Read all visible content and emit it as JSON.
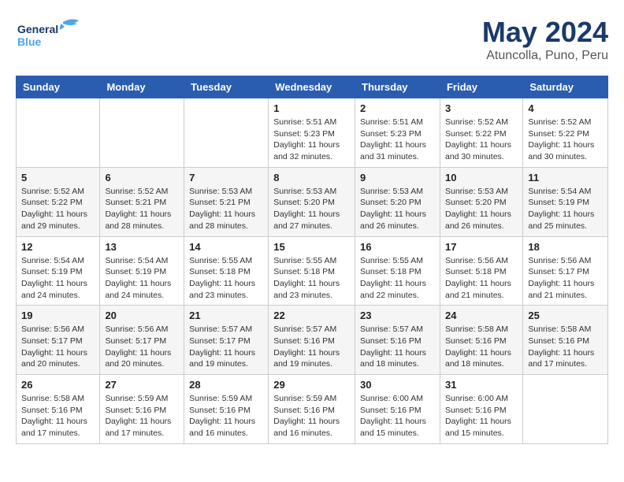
{
  "header": {
    "logo_general": "General",
    "logo_blue": "Blue",
    "main_title": "May 2024",
    "subtitle": "Atuncolla, Puno, Peru"
  },
  "weekdays": [
    "Sunday",
    "Monday",
    "Tuesday",
    "Wednesday",
    "Thursday",
    "Friday",
    "Saturday"
  ],
  "weeks": [
    [
      {
        "day": "",
        "sunrise": "",
        "sunset": "",
        "daylight": ""
      },
      {
        "day": "",
        "sunrise": "",
        "sunset": "",
        "daylight": ""
      },
      {
        "day": "",
        "sunrise": "",
        "sunset": "",
        "daylight": ""
      },
      {
        "day": "1",
        "sunrise": "Sunrise: 5:51 AM",
        "sunset": "Sunset: 5:23 PM",
        "daylight": "Daylight: 11 hours and 32 minutes."
      },
      {
        "day": "2",
        "sunrise": "Sunrise: 5:51 AM",
        "sunset": "Sunset: 5:23 PM",
        "daylight": "Daylight: 11 hours and 31 minutes."
      },
      {
        "day": "3",
        "sunrise": "Sunrise: 5:52 AM",
        "sunset": "Sunset: 5:22 PM",
        "daylight": "Daylight: 11 hours and 30 minutes."
      },
      {
        "day": "4",
        "sunrise": "Sunrise: 5:52 AM",
        "sunset": "Sunset: 5:22 PM",
        "daylight": "Daylight: 11 hours and 30 minutes."
      }
    ],
    [
      {
        "day": "5",
        "sunrise": "Sunrise: 5:52 AM",
        "sunset": "Sunset: 5:22 PM",
        "daylight": "Daylight: 11 hours and 29 minutes."
      },
      {
        "day": "6",
        "sunrise": "Sunrise: 5:52 AM",
        "sunset": "Sunset: 5:21 PM",
        "daylight": "Daylight: 11 hours and 28 minutes."
      },
      {
        "day": "7",
        "sunrise": "Sunrise: 5:53 AM",
        "sunset": "Sunset: 5:21 PM",
        "daylight": "Daylight: 11 hours and 28 minutes."
      },
      {
        "day": "8",
        "sunrise": "Sunrise: 5:53 AM",
        "sunset": "Sunset: 5:20 PM",
        "daylight": "Daylight: 11 hours and 27 minutes."
      },
      {
        "day": "9",
        "sunrise": "Sunrise: 5:53 AM",
        "sunset": "Sunset: 5:20 PM",
        "daylight": "Daylight: 11 hours and 26 minutes."
      },
      {
        "day": "10",
        "sunrise": "Sunrise: 5:53 AM",
        "sunset": "Sunset: 5:20 PM",
        "daylight": "Daylight: 11 hours and 26 minutes."
      },
      {
        "day": "11",
        "sunrise": "Sunrise: 5:54 AM",
        "sunset": "Sunset: 5:19 PM",
        "daylight": "Daylight: 11 hours and 25 minutes."
      }
    ],
    [
      {
        "day": "12",
        "sunrise": "Sunrise: 5:54 AM",
        "sunset": "Sunset: 5:19 PM",
        "daylight": "Daylight: 11 hours and 24 minutes."
      },
      {
        "day": "13",
        "sunrise": "Sunrise: 5:54 AM",
        "sunset": "Sunset: 5:19 PM",
        "daylight": "Daylight: 11 hours and 24 minutes."
      },
      {
        "day": "14",
        "sunrise": "Sunrise: 5:55 AM",
        "sunset": "Sunset: 5:18 PM",
        "daylight": "Daylight: 11 hours and 23 minutes."
      },
      {
        "day": "15",
        "sunrise": "Sunrise: 5:55 AM",
        "sunset": "Sunset: 5:18 PM",
        "daylight": "Daylight: 11 hours and 23 minutes."
      },
      {
        "day": "16",
        "sunrise": "Sunrise: 5:55 AM",
        "sunset": "Sunset: 5:18 PM",
        "daylight": "Daylight: 11 hours and 22 minutes."
      },
      {
        "day": "17",
        "sunrise": "Sunrise: 5:56 AM",
        "sunset": "Sunset: 5:18 PM",
        "daylight": "Daylight: 11 hours and 21 minutes."
      },
      {
        "day": "18",
        "sunrise": "Sunrise: 5:56 AM",
        "sunset": "Sunset: 5:17 PM",
        "daylight": "Daylight: 11 hours and 21 minutes."
      }
    ],
    [
      {
        "day": "19",
        "sunrise": "Sunrise: 5:56 AM",
        "sunset": "Sunset: 5:17 PM",
        "daylight": "Daylight: 11 hours and 20 minutes."
      },
      {
        "day": "20",
        "sunrise": "Sunrise: 5:56 AM",
        "sunset": "Sunset: 5:17 PM",
        "daylight": "Daylight: 11 hours and 20 minutes."
      },
      {
        "day": "21",
        "sunrise": "Sunrise: 5:57 AM",
        "sunset": "Sunset: 5:17 PM",
        "daylight": "Daylight: 11 hours and 19 minutes."
      },
      {
        "day": "22",
        "sunrise": "Sunrise: 5:57 AM",
        "sunset": "Sunset: 5:16 PM",
        "daylight": "Daylight: 11 hours and 19 minutes."
      },
      {
        "day": "23",
        "sunrise": "Sunrise: 5:57 AM",
        "sunset": "Sunset: 5:16 PM",
        "daylight": "Daylight: 11 hours and 18 minutes."
      },
      {
        "day": "24",
        "sunrise": "Sunrise: 5:58 AM",
        "sunset": "Sunset: 5:16 PM",
        "daylight": "Daylight: 11 hours and 18 minutes."
      },
      {
        "day": "25",
        "sunrise": "Sunrise: 5:58 AM",
        "sunset": "Sunset: 5:16 PM",
        "daylight": "Daylight: 11 hours and 17 minutes."
      }
    ],
    [
      {
        "day": "26",
        "sunrise": "Sunrise: 5:58 AM",
        "sunset": "Sunset: 5:16 PM",
        "daylight": "Daylight: 11 hours and 17 minutes."
      },
      {
        "day": "27",
        "sunrise": "Sunrise: 5:59 AM",
        "sunset": "Sunset: 5:16 PM",
        "daylight": "Daylight: 11 hours and 17 minutes."
      },
      {
        "day": "28",
        "sunrise": "Sunrise: 5:59 AM",
        "sunset": "Sunset: 5:16 PM",
        "daylight": "Daylight: 11 hours and 16 minutes."
      },
      {
        "day": "29",
        "sunrise": "Sunrise: 5:59 AM",
        "sunset": "Sunset: 5:16 PM",
        "daylight": "Daylight: 11 hours and 16 minutes."
      },
      {
        "day": "30",
        "sunrise": "Sunrise: 6:00 AM",
        "sunset": "Sunset: 5:16 PM",
        "daylight": "Daylight: 11 hours and 15 minutes."
      },
      {
        "day": "31",
        "sunrise": "Sunrise: 6:00 AM",
        "sunset": "Sunset: 5:16 PM",
        "daylight": "Daylight: 11 hours and 15 minutes."
      },
      {
        "day": "",
        "sunrise": "",
        "sunset": "",
        "daylight": ""
      }
    ]
  ]
}
